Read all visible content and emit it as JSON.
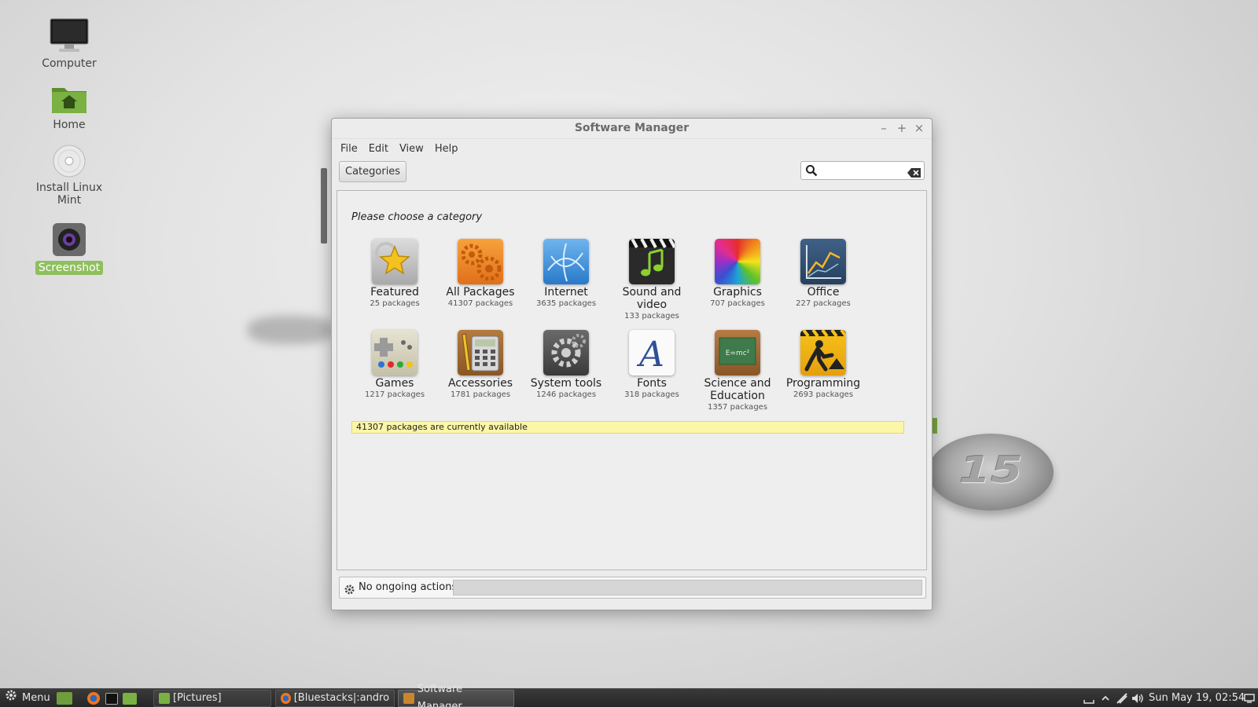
{
  "desktop": {
    "icons": [
      {
        "label": "Computer"
      },
      {
        "label": "Home"
      },
      {
        "label": "Install Linux Mint"
      },
      {
        "label": "Screenshot"
      }
    ],
    "badge_text": "15"
  },
  "window": {
    "title": "Software Manager",
    "controls": {
      "minimize": "–",
      "maximize": "+",
      "close": "×"
    },
    "menu": [
      "File",
      "Edit",
      "View",
      "Help"
    ],
    "categories_button": "Categories",
    "search": {
      "value": "",
      "placeholder": ""
    },
    "heading": "Please choose a category",
    "categories": [
      {
        "name": "Featured",
        "count": "25 packages",
        "icon": "star-icon"
      },
      {
        "name": "All Packages",
        "count": "41307 packages",
        "icon": "gears-icon"
      },
      {
        "name": "Internet",
        "count": "3635 packages",
        "icon": "globe-icon"
      },
      {
        "name": "Sound and video",
        "count": "133 packages",
        "icon": "clapperboard-music-icon"
      },
      {
        "name": "Graphics",
        "count": "707 packages",
        "icon": "color-wheel-icon"
      },
      {
        "name": "Office",
        "count": "227 packages",
        "icon": "line-chart-icon"
      },
      {
        "name": "Games",
        "count": "1217 packages",
        "icon": "gamepad-icon"
      },
      {
        "name": "Accessories",
        "count": "1781 packages",
        "icon": "calculator-icon"
      },
      {
        "name": "System tools",
        "count": "1246 packages",
        "icon": "gear-icon"
      },
      {
        "name": "Fonts",
        "count": "318 packages",
        "icon": "font-icon"
      },
      {
        "name": "Science and Education",
        "count": "1357 packages",
        "icon": "chalkboard-icon"
      },
      {
        "name": "Programming",
        "count": "2693 packages",
        "icon": "construction-icon"
      }
    ],
    "available_text": "41307 packages are currently available",
    "status_text": "No ongoing actions"
  },
  "taskbar": {
    "menu_label": "Menu",
    "windows": [
      {
        "label": "[Pictures]"
      },
      {
        "label": "[Bluestacks|:andro..."
      },
      {
        "label": "Software Manager"
      }
    ],
    "clock": "Sun May 19, 02:54"
  },
  "colors": {
    "accent_green": "#8fbf5e",
    "highlight_yellow": "#fbf6a8",
    "taskbar": "#2e2e2e"
  }
}
